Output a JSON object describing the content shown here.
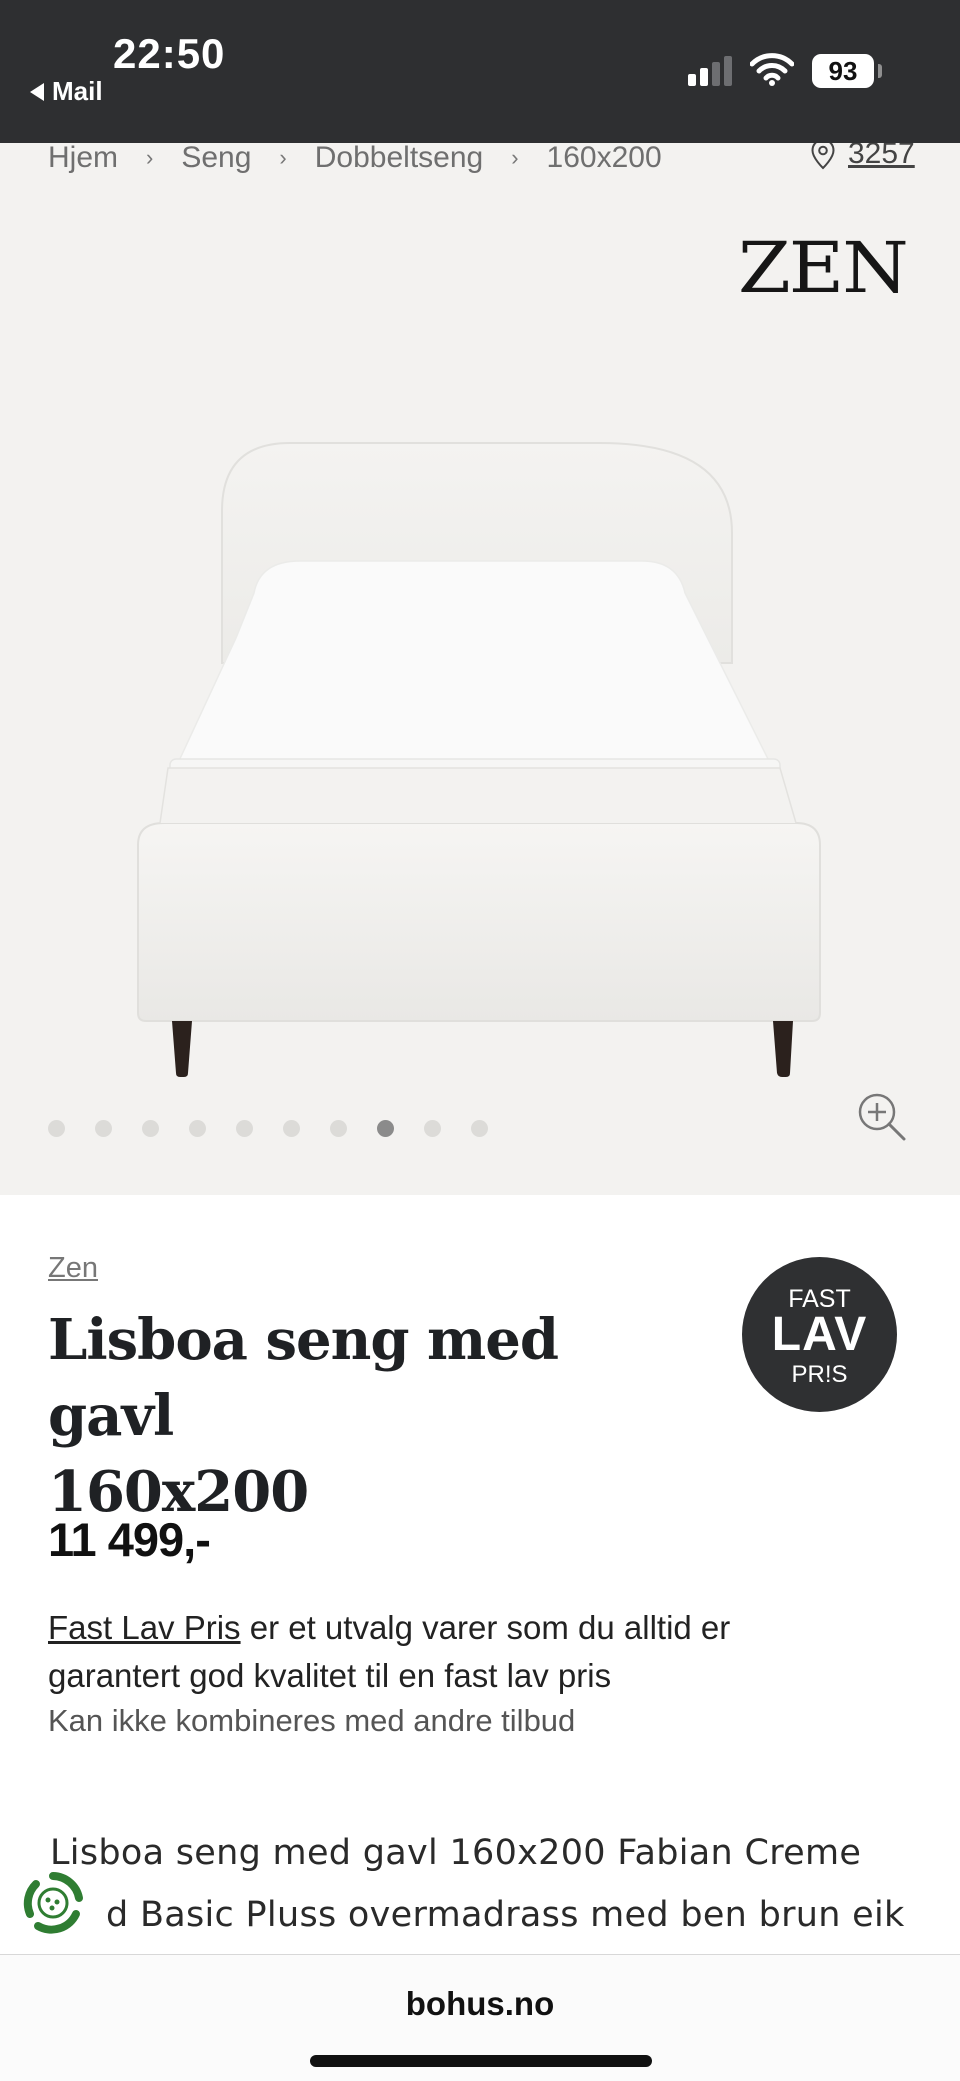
{
  "status_bar": {
    "time": "22:50",
    "back_label": "Mail",
    "battery": "93"
  },
  "breadcrumb": {
    "items": [
      "Hjem",
      "Seng",
      "Dobbeltseng",
      "160x200"
    ],
    "separator": "›"
  },
  "store": {
    "number": "3257",
    "icon": "location-pin-icon"
  },
  "gallery": {
    "brand_logo": "ZEN",
    "image_count": 10,
    "active_index": 7,
    "zoom_icon": "zoom-in-icon"
  },
  "product": {
    "brand": "Zen",
    "title_line1": "Lisboa seng med gavl",
    "title_line2": "160x200",
    "price": "11 499,-",
    "badge": {
      "line1": "FAST",
      "line2": "LAV",
      "line3": "PR!S"
    },
    "promo_link": "Fast Lav Pris",
    "promo_text_1": " er et utvalg varer som du alltid er",
    "promo_text_2": "garantert god kvalitet til en fast lav pris",
    "promo_note": "Kan ikke kombineres med andre tilbud",
    "description_line1": "Lisboa seng med gavl 160x200 Fabian Creme",
    "description_line2": "d Basic Pluss overmadrass med ben brun eik"
  },
  "browser": {
    "domain": "bohus.no"
  },
  "colors": {
    "status_bar": "#2e2f31",
    "gallery_bg": "#f3f2f0",
    "badge_bg": "#2f3032",
    "eco_green": "#2f7d32"
  }
}
